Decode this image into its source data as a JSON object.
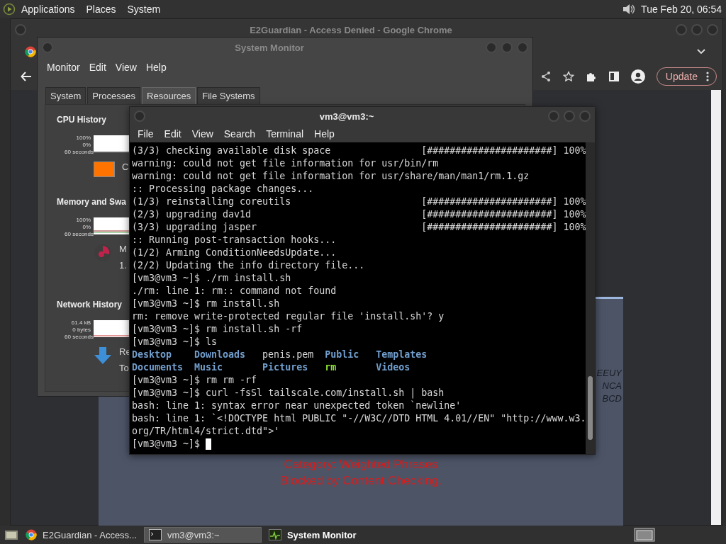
{
  "top_panel": {
    "menus": [
      "Applications",
      "Places",
      "System"
    ],
    "clock": "Tue Feb 20, 06:54"
  },
  "browser": {
    "title": "E2Guardian - Access Denied - Google Chrome",
    "update_button": "Update",
    "page_lines": [
      "Category: Weighted Phrases",
      "Blocked by Content Checking."
    ],
    "side_fragments": [
      "EEUY",
      "NCA",
      "BCD"
    ]
  },
  "system_monitor": {
    "title": "System Monitor",
    "menu": [
      "Monitor",
      "Edit",
      "View",
      "Help"
    ],
    "tabs": [
      {
        "label": "System",
        "selected": false
      },
      {
        "label": "Processes",
        "selected": false
      },
      {
        "label": "Resources",
        "selected": true
      },
      {
        "label": "File Systems",
        "selected": false
      }
    ],
    "sections": [
      {
        "kind": "cpu",
        "title": "CPU History",
        "y_max": "100%",
        "y_min": "0%",
        "x_label": "60 seconds",
        "legend": [
          "C"
        ]
      },
      {
        "kind": "memory",
        "title": "Memory and Swa",
        "y_max": "100%",
        "y_min": "0%",
        "x_label": "60 seconds",
        "legend": [
          "M",
          "1."
        ]
      },
      {
        "kind": "network",
        "title": "Network History",
        "y_max": "61.4 kB",
        "y_min": "0 bytes",
        "x_label": "60 seconds",
        "legend": [
          "Re",
          "To"
        ]
      }
    ]
  },
  "terminal": {
    "title": "vm3@vm3:~",
    "menu": [
      "File",
      "Edit",
      "View",
      "Search",
      "Terminal",
      "Help"
    ],
    "lines": [
      {
        "kind": "progress",
        "text": "(3/3) checking available disk space",
        "bar": "[######################]",
        "percent": "100%"
      },
      {
        "kind": "text",
        "text": "warning: could not get file information for usr/bin/rm"
      },
      {
        "kind": "text",
        "text": "warning: could not get file information for usr/share/man/man1/rm.1.gz"
      },
      {
        "kind": "text",
        "text": ":: Processing package changes..."
      },
      {
        "kind": "progress",
        "text": "(1/3) reinstalling coreutils",
        "bar": "[######################]",
        "percent": "100%"
      },
      {
        "kind": "progress",
        "text": "(2/3) upgrading dav1d",
        "bar": "[######################]",
        "percent": "100%"
      },
      {
        "kind": "progress",
        "text": "(3/3) upgrading jasper",
        "bar": "[######################]",
        "percent": "100%"
      },
      {
        "kind": "text",
        "text": ":: Running post-transaction hooks..."
      },
      {
        "kind": "text",
        "text": "(1/2) Arming ConditionNeedsUpdate..."
      },
      {
        "kind": "text",
        "text": "(2/2) Updating the info directory file..."
      },
      {
        "kind": "text",
        "text": "[vm3@vm3 ~]$ ./rm install.sh"
      },
      {
        "kind": "text",
        "text": "./rm: line 1: rm:: command not found"
      },
      {
        "kind": "text",
        "text": "[vm3@vm3 ~]$ rm install.sh"
      },
      {
        "kind": "text",
        "text": "rm: remove write-protected regular file 'install.sh'? y"
      },
      {
        "kind": "text",
        "text": "[vm3@vm3 ~]$ rm install.sh -rf"
      },
      {
        "kind": "text",
        "text": "[vm3@vm3 ~]$ ls"
      },
      {
        "kind": "listing",
        "cells": [
          {
            "text": "Desktop",
            "kind": "dir"
          },
          {
            "text": "Downloads",
            "kind": "dir"
          },
          {
            "text": "penis.pem",
            "kind": "file"
          },
          {
            "text": "Public",
            "kind": "dir"
          },
          {
            "text": "Templates",
            "kind": "dir"
          }
        ]
      },
      {
        "kind": "listing",
        "cells": [
          {
            "text": "Documents",
            "kind": "dir"
          },
          {
            "text": "Music",
            "kind": "dir"
          },
          {
            "text": "Pictures",
            "kind": "dir"
          },
          {
            "text": "rm",
            "kind": "exec"
          },
          {
            "text": "Videos",
            "kind": "dir"
          }
        ]
      },
      {
        "kind": "text",
        "text": "[vm3@vm3 ~]$ rm rm -rf"
      },
      {
        "kind": "text",
        "text": "[vm3@vm3 ~]$ curl -fsSl tailscale.com/install.sh | bash"
      },
      {
        "kind": "text",
        "text": "bash: line 1: syntax error near unexpected token `newline'"
      },
      {
        "kind": "text",
        "text": "bash: line 1: `<!DOCTYPE html PUBLIC \"-//W3C//DTD HTML 4.01//EN\" \"http://www.w3.org/TR/html4/strict.dtd\">'"
      },
      {
        "kind": "prompt",
        "text": "[vm3@vm3 ~]$"
      }
    ]
  },
  "taskbar": {
    "items": [
      {
        "label": "E2Guardian - Access...",
        "kind": "browser",
        "selected": false,
        "attention": false
      },
      {
        "label": "vm3@vm3:~",
        "kind": "terminal",
        "selected": true,
        "attention": false
      },
      {
        "label": "System Monitor",
        "kind": "monitor",
        "selected": false,
        "attention": true
      }
    ]
  }
}
